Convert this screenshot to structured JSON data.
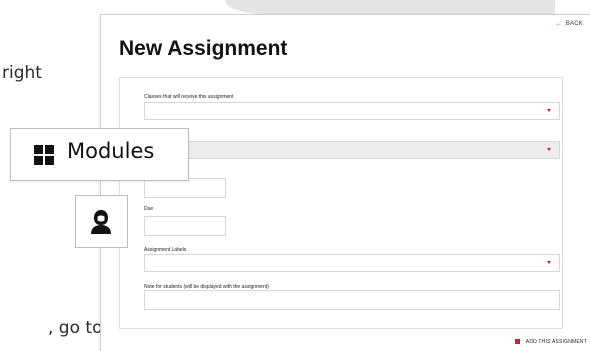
{
  "background": {
    "text_top": "right",
    "text_bottom": ", go to"
  },
  "app": {
    "back_label": "BACK",
    "title": "New Assignment"
  },
  "form": {
    "classes_label": "Classes that will receive this assignment",
    "due_label": "Due",
    "assignment_labels_label": "Assignment Labels",
    "note_label": "Note for students (will be displayed with the assignment)",
    "add_button_label": "ADD THIS ASSIGNMENT"
  },
  "callouts": {
    "modules_label": "Modules"
  },
  "colors": {
    "accent": "#cc2233"
  },
  "icons": {
    "back": "back-arrow-icon",
    "dropdown": "dropdown-caret-icon",
    "modules": "grid-icon",
    "avatar": "user-avatar-icon",
    "add": "add-assignment-icon"
  }
}
